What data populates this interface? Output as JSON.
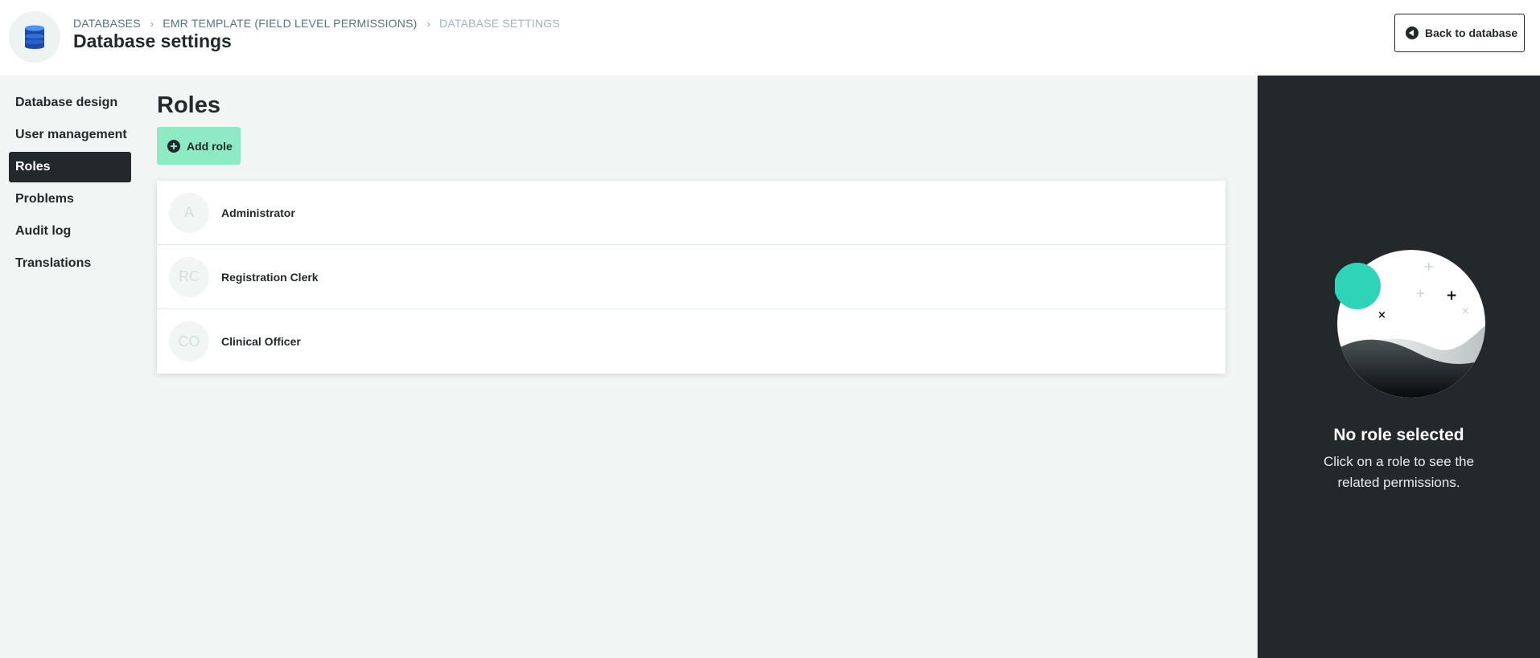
{
  "header": {
    "breadcrumb": [
      "DATABASES",
      "EMR TEMPLATE (FIELD LEVEL PERMISSIONS)",
      "DATABASE SETTINGS"
    ],
    "page_title": "Database settings",
    "back_button_label": "Back to database"
  },
  "sidebar": {
    "items": [
      {
        "label": "Database design",
        "active": false
      },
      {
        "label": "User management",
        "active": false
      },
      {
        "label": "Roles",
        "active": true
      },
      {
        "label": "Problems",
        "active": false
      },
      {
        "label": "Audit log",
        "active": false
      },
      {
        "label": "Translations",
        "active": false
      }
    ]
  },
  "main": {
    "title": "Roles",
    "add_role_label": "Add role",
    "roles": [
      {
        "initials": "A",
        "name": "Administrator"
      },
      {
        "initials": "RC",
        "name": "Registration Clerk"
      },
      {
        "initials": "CO",
        "name": "Clinical Officer"
      }
    ]
  },
  "right_panel": {
    "title": "No role selected",
    "description": "Click on a role to see the related permissions."
  },
  "colors": {
    "dark": "#23292a",
    "accent_green": "#8deac3",
    "teal": "#2ed3b8",
    "page_bg": "#f1f6f5",
    "breadcrumb": "#547476"
  },
  "icons": {
    "logo": "database-icon",
    "back": "arrow-left-circle-icon",
    "add": "plus-circle-icon",
    "breadcrumb_separator": "chevron-right-icon"
  }
}
